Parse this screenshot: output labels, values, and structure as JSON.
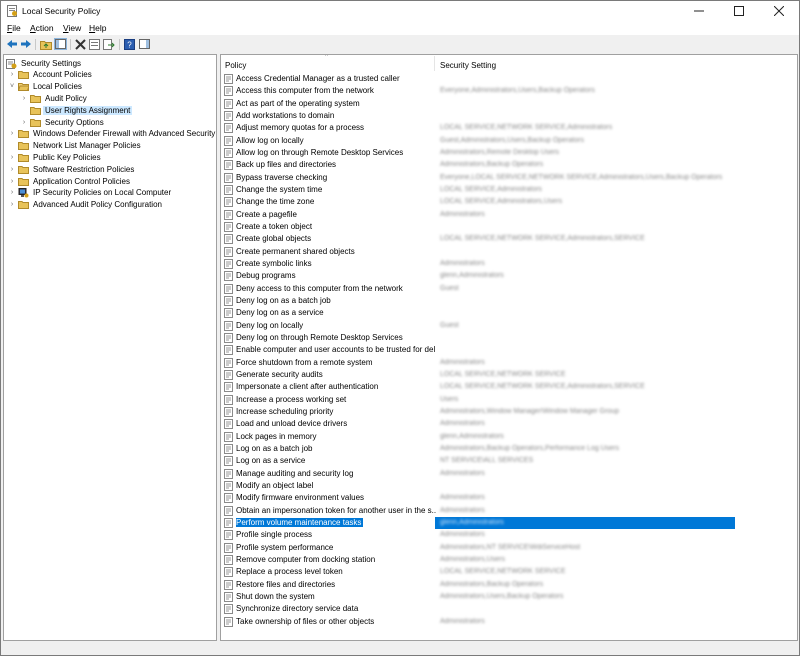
{
  "window": {
    "title": "Local Security Policy"
  },
  "menu": [
    {
      "label": "File",
      "u": "F",
      "rest": "ile"
    },
    {
      "label": "Action",
      "u": "A",
      "rest": "ction"
    },
    {
      "label": "View",
      "u": "V",
      "rest": "iew"
    },
    {
      "label": "Help",
      "u": "H",
      "rest": "elp"
    }
  ],
  "toolbar_icons": [
    "back-arrow-icon",
    "forward-arrow-icon",
    "up-folder-icon",
    "show-hide-tree-icon",
    "delete-icon",
    "properties-icon",
    "export-list-icon",
    "help-icon",
    "action-pane-icon"
  ],
  "tree": [
    {
      "label": "Security Settings",
      "level": 0,
      "expander": "",
      "icon": "security-settings-icon"
    },
    {
      "label": "Account Policies",
      "level": 1,
      "expander": ">",
      "icon": "folder-icon"
    },
    {
      "label": "Local Policies",
      "level": 1,
      "expander": "v",
      "icon": "folder-open-icon"
    },
    {
      "label": "Audit Policy",
      "level": 2,
      "expander": ">",
      "icon": "folder-icon"
    },
    {
      "label": "User Rights Assignment",
      "level": 2,
      "expander": "",
      "icon": "folder-icon",
      "selected": true
    },
    {
      "label": "Security Options",
      "level": 2,
      "expander": ">",
      "icon": "folder-icon"
    },
    {
      "label": "Windows Defender Firewall with Advanced Security",
      "level": 1,
      "expander": ">",
      "icon": "folder-icon"
    },
    {
      "label": "Network List Manager Policies",
      "level": 1,
      "expander": "",
      "icon": "folder-icon"
    },
    {
      "label": "Public Key Policies",
      "level": 1,
      "expander": ">",
      "icon": "folder-icon"
    },
    {
      "label": "Software Restriction Policies",
      "level": 1,
      "expander": ">",
      "icon": "folder-icon"
    },
    {
      "label": "Application Control Policies",
      "level": 1,
      "expander": ">",
      "icon": "folder-icon"
    },
    {
      "label": "IP Security Policies on Local Computer",
      "level": 1,
      "expander": ">",
      "icon": "ip-security-icon"
    },
    {
      "label": "Advanced Audit Policy Configuration",
      "level": 1,
      "expander": ">",
      "icon": "folder-icon"
    }
  ],
  "columns": {
    "policy": "Policy",
    "setting": "Security Setting"
  },
  "policies": [
    {
      "name": "Access Credential Manager as a trusted caller",
      "setting": ""
    },
    {
      "name": "Access this computer from the network",
      "setting": "Everyone,Administrators,Users,Backup Operators"
    },
    {
      "name": "Act as part of the operating system",
      "setting": ""
    },
    {
      "name": "Add workstations to domain",
      "setting": ""
    },
    {
      "name": "Adjust memory quotas for a process",
      "setting": "LOCAL SERVICE,NETWORK SERVICE,Administrators"
    },
    {
      "name": "Allow log on locally",
      "setting": "Guest,Administrators,Users,Backup Operators"
    },
    {
      "name": "Allow log on through Remote Desktop Services",
      "setting": "Administrators,Remote Desktop Users"
    },
    {
      "name": "Back up files and directories",
      "setting": "Administrators,Backup Operators"
    },
    {
      "name": "Bypass traverse checking",
      "setting": "Everyone,LOCAL SERVICE,NETWORK SERVICE,Administrators,Users,Backup Operators"
    },
    {
      "name": "Change the system time",
      "setting": "LOCAL SERVICE,Administrators"
    },
    {
      "name": "Change the time zone",
      "setting": "LOCAL SERVICE,Administrators,Users"
    },
    {
      "name": "Create a pagefile",
      "setting": "Administrators"
    },
    {
      "name": "Create a token object",
      "setting": ""
    },
    {
      "name": "Create global objects",
      "setting": "LOCAL SERVICE,NETWORK SERVICE,Administrators,SERVICE"
    },
    {
      "name": "Create permanent shared objects",
      "setting": ""
    },
    {
      "name": "Create symbolic links",
      "setting": "Administrators"
    },
    {
      "name": "Debug programs",
      "setting": "glenn,Administrators"
    },
    {
      "name": "Deny access to this computer from the network",
      "setting": "Guest"
    },
    {
      "name": "Deny log on as a batch job",
      "setting": ""
    },
    {
      "name": "Deny log on as a service",
      "setting": ""
    },
    {
      "name": "Deny log on locally",
      "setting": "Guest"
    },
    {
      "name": "Deny log on through Remote Desktop Services",
      "setting": ""
    },
    {
      "name": "Enable computer and user accounts to be trusted for del...",
      "setting": ""
    },
    {
      "name": "Force shutdown from a remote system",
      "setting": "Administrators"
    },
    {
      "name": "Generate security audits",
      "setting": "LOCAL SERVICE,NETWORK SERVICE"
    },
    {
      "name": "Impersonate a client after authentication",
      "setting": "LOCAL SERVICE,NETWORK SERVICE,Administrators,SERVICE"
    },
    {
      "name": "Increase a process working set",
      "setting": "Users"
    },
    {
      "name": "Increase scheduling priority",
      "setting": "Administrators,Window Manager\\Window Manager Group"
    },
    {
      "name": "Load and unload device drivers",
      "setting": "Administrators"
    },
    {
      "name": "Lock pages in memory",
      "setting": "glenn,Administrators"
    },
    {
      "name": "Log on as a batch job",
      "setting": "Administrators,Backup Operators,Performance Log Users"
    },
    {
      "name": "Log on as a service",
      "setting": "NT SERVICE\\ALL SERVICES"
    },
    {
      "name": "Manage auditing and security log",
      "setting": "Administrators"
    },
    {
      "name": "Modify an object label",
      "setting": ""
    },
    {
      "name": "Modify firmware environment values",
      "setting": "Administrators"
    },
    {
      "name": "Obtain an impersonation token for another user in the s...",
      "setting": "Administrators"
    },
    {
      "name": "Perform volume maintenance tasks",
      "setting": "glenn,Administrators",
      "selected": true
    },
    {
      "name": "Profile single process",
      "setting": "Administrators"
    },
    {
      "name": "Profile system performance",
      "setting": "Administrators,NT SERVICE\\WdiServiceHost"
    },
    {
      "name": "Remove computer from docking station",
      "setting": "Administrators,Users"
    },
    {
      "name": "Replace a process level token",
      "setting": "LOCAL SERVICE,NETWORK SERVICE"
    },
    {
      "name": "Restore files and directories",
      "setting": "Administrators,Backup Operators"
    },
    {
      "name": "Shut down the system",
      "setting": "Administrators,Users,Backup Operators"
    },
    {
      "name": "Synchronize directory service data",
      "setting": ""
    },
    {
      "name": "Take ownership of files or other objects",
      "setting": "Administrators"
    }
  ],
  "colors": {
    "selection": "#0078d7",
    "tree_selection": "#cce8ff",
    "folder": "#e8c35a"
  }
}
